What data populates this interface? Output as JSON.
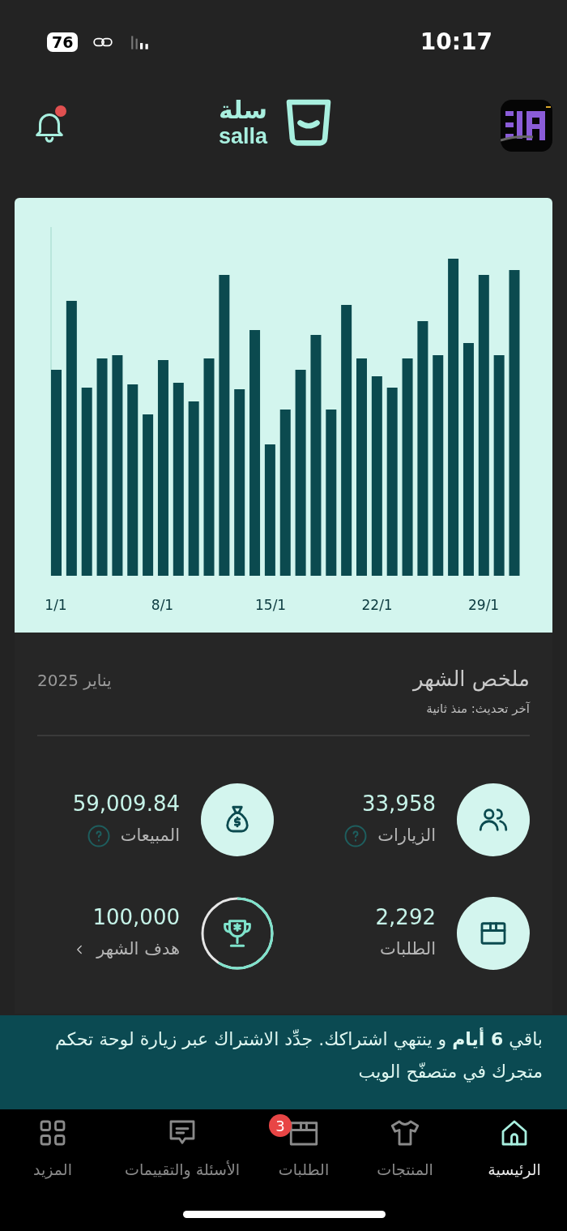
{
  "status_bar": {
    "battery": "76",
    "time": "10:17"
  },
  "header": {
    "logo_arabic": "سلة",
    "logo_latin": "salla",
    "notification_dot": true
  },
  "chart": {
    "x_labels": [
      "29/1",
      "22/1",
      "15/1",
      "8/1",
      "1/1"
    ]
  },
  "summary": {
    "title": "ملخص الشهر",
    "period": "يناير 2025",
    "updated": "آخر تحديث: منذ ثانية",
    "stats": [
      {
        "kind": "visits",
        "value": "33,958",
        "label": "الزيارات",
        "help": true
      },
      {
        "kind": "sales",
        "value": "59,009.84",
        "label": "المبيعات",
        "help": true
      },
      {
        "kind": "orders",
        "value": "2,292",
        "label": "الطلبات",
        "help": false
      },
      {
        "kind": "goal",
        "value": "100,000",
        "label": "هدف الشهر",
        "help": false
      }
    ]
  },
  "banner": {
    "text": "باقي **6 أيام** و ينتهي اشتراكك. جدِّد الاشتراك عبر زيارة لوحة تحكم متجرك في متصفّح الويب"
  },
  "nav": [
    {
      "kind": "home",
      "label": "الرئيسية",
      "selected": true
    },
    {
      "kind": "products",
      "label": "المنتجات",
      "selected": false
    },
    {
      "kind": "orders",
      "label": "الطلبات",
      "selected": false,
      "badge": "3"
    },
    {
      "kind": "reviews",
      "label": "الأسئلة والتقييمات",
      "selected": false
    },
    {
      "kind": "more",
      "label": "المزيد",
      "selected": false
    }
  ]
}
